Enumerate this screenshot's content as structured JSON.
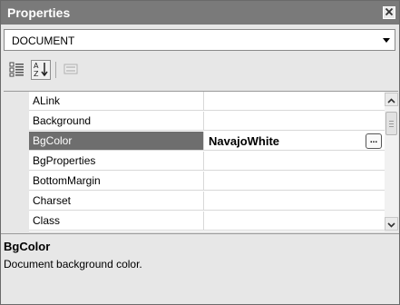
{
  "window": {
    "title": "Properties"
  },
  "object_selector": {
    "value": "DOCUMENT"
  },
  "toolbar": {
    "categorized_icon": "categorized-icon",
    "alphabetical_icon": "alphabetical-sort-icon",
    "property_pages_icon": "property-pages-icon"
  },
  "properties": [
    {
      "name": "ALink",
      "value": ""
    },
    {
      "name": "Background",
      "value": ""
    },
    {
      "name": "BgColor",
      "value": "NavajoWhite",
      "selected": true
    },
    {
      "name": "BgProperties",
      "value": ""
    },
    {
      "name": "BottomMargin",
      "value": ""
    },
    {
      "name": "Charset",
      "value": ""
    },
    {
      "name": "Class",
      "value": ""
    }
  ],
  "ellipsis_label": "...",
  "description": {
    "title": "BgColor",
    "text": "Document background color."
  }
}
